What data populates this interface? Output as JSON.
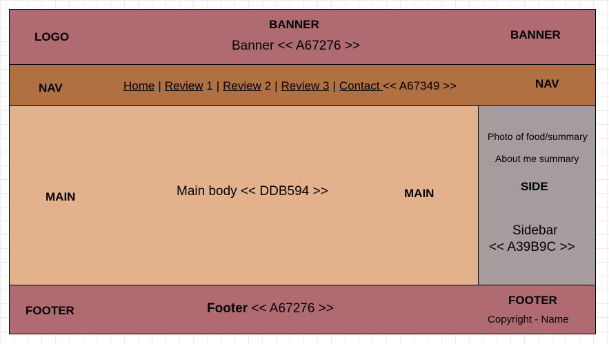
{
  "banner": {
    "logo": "LOGO",
    "title": "BANNER",
    "text": "Banner << A67276 >>",
    "right_label": "BANNER",
    "color": "#b06b72"
  },
  "nav": {
    "label": "NAV",
    "right_label": "NAV",
    "links": [
      {
        "text": "Home",
        "suffix": ""
      },
      {
        "text": "Review",
        "suffix": " 1"
      },
      {
        "text": "Review",
        "suffix": " 2"
      },
      {
        "text": "Review 3",
        "suffix": ""
      },
      {
        "text": "Contact ",
        "suffix": ""
      }
    ],
    "separator": "|",
    "code": "<< A67349 >>",
    "color": "#b07042"
  },
  "main": {
    "left_label": "MAIN",
    "text": "Main body  << DDB594 >>",
    "right_label": "MAIN",
    "color": "#e3b28d"
  },
  "side": {
    "photo": "Photo of food/summary",
    "about": "About me summary",
    "label": "SIDE",
    "text_line1": "Sidebar",
    "text_line2": "<< A39B9C >>",
    "color": "#a69c9e"
  },
  "footer": {
    "label": "FOOTER",
    "title": "Footer",
    "code": " << A67276 >>",
    "right_label": "FOOTER",
    "copyright": "Copyright - Name",
    "color": "#b06b72"
  }
}
